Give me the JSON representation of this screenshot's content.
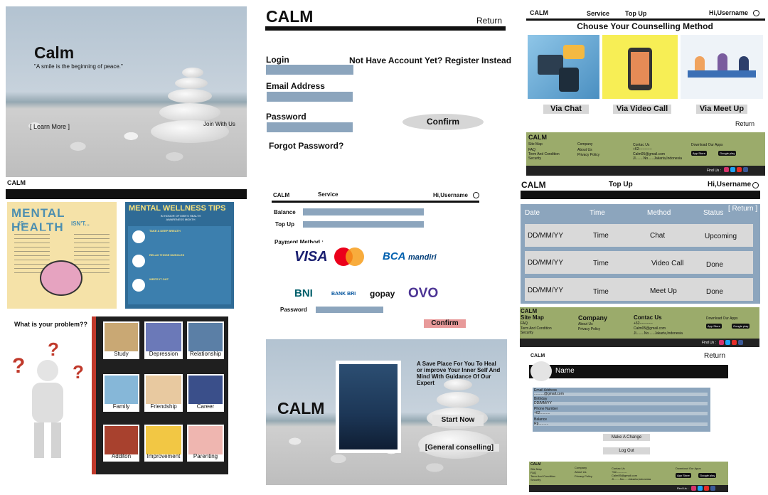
{
  "landing": {
    "title": "Calm",
    "quote": "\"A smile is the beginning of peace.\"",
    "learn_more": "[ Learn More ]",
    "join": "Join With Us"
  },
  "login": {
    "brand": "CALM",
    "return": "Return",
    "login_label": "Login",
    "register": "Not Have Account Yet? Register Instead",
    "email_label": "Email Address",
    "password_label": "Password",
    "confirm": "Confirm",
    "forgot": "Forgot Password?"
  },
  "counselling": {
    "brand": "CALM",
    "nav_service": "Service",
    "nav_topup": "Top Up",
    "greeting": "Hi,Username",
    "heading": "Chouse Your Counselling Method",
    "chat": "Via Chat",
    "video": "Via Video Call",
    "meet": "Via Meet Up",
    "return": "Return"
  },
  "footer": {
    "brand": "CALM",
    "site_map": "Site Map",
    "faq": "FAQ",
    "terms": "Term And Condition",
    "security": "Security",
    "company": "Company",
    "about": "About Us",
    "privacy": "Privacy Policy",
    "contact": "Contac Us",
    "phone": "+62-----------",
    "email": "Calm05@gmail.com",
    "address": "Jl........No......Jakarta,Indonesia",
    "download": "Download Our Apps",
    "app_store": "App Store",
    "google_play": "Google play",
    "find_us": "Find Us :"
  },
  "left_mid": {
    "brand": "CALM",
    "poster1": "MENTAL HEALTH",
    "poster1_is": "IS...",
    "poster1_isnt": "ISN'T...",
    "poster2": "MENTAL WELLNESS TIPS",
    "poster2_sub": "IN HONOR OF MEN'S HEALTH AWARENESS MONTH",
    "tips": [
      "TAKE A DEEP BREATH",
      "RELAX THOSE MUSCLES",
      "WRITE IT OUT"
    ]
  },
  "problems": {
    "question": "What is your problem??",
    "items": [
      "Study",
      "Depression",
      "Relationship",
      "Family",
      "Friendship",
      "Career",
      "Additon",
      "Improvement",
      "Parenting"
    ]
  },
  "topup": {
    "brand": "CALM",
    "service": "Service",
    "greeting": "Hi,Username",
    "balance": "Balance",
    "topup": "Top Up",
    "payment": "Payment Method :",
    "logos": [
      "VISA",
      "BCA",
      "mandiri",
      "BNI",
      "BANK BRI",
      "gopay",
      "OVO"
    ],
    "password": "Password",
    "confirm": "Confirm"
  },
  "hero": {
    "title": "CALM",
    "text": "A Save Place For You To Heal or improve Your Inner Self And Mind With Guidance Of Our Expert",
    "start": "Start Now",
    "general": "[General conselling]"
  },
  "history": {
    "brand": "CALM",
    "topup": "Top Up",
    "greeting": "Hi,Username",
    "return": "[ Return ]",
    "headers": [
      "Date",
      "Time",
      "Method",
      "Status"
    ],
    "rows": [
      [
        "DD/MM/YY",
        "Time",
        "Chat",
        "Upcoming"
      ],
      [
        "DD/MM/YY",
        "Time",
        "Video Call",
        "Done"
      ],
      [
        "DD/MM/YY",
        "Time",
        "Meet Up",
        "Done"
      ]
    ]
  },
  "profile": {
    "brand": "CALM",
    "return": "Return",
    "name": "Name",
    "fields": [
      [
        "Email Address",
        "..........@gmail.com"
      ],
      [
        "Birthday",
        "DD/MM/YY"
      ],
      [
        "Phone Number",
        "+62.........."
      ],
      [
        "Balance",
        "Rp.........."
      ]
    ],
    "make_change": "Make A Change",
    "logout": "Log Out"
  }
}
